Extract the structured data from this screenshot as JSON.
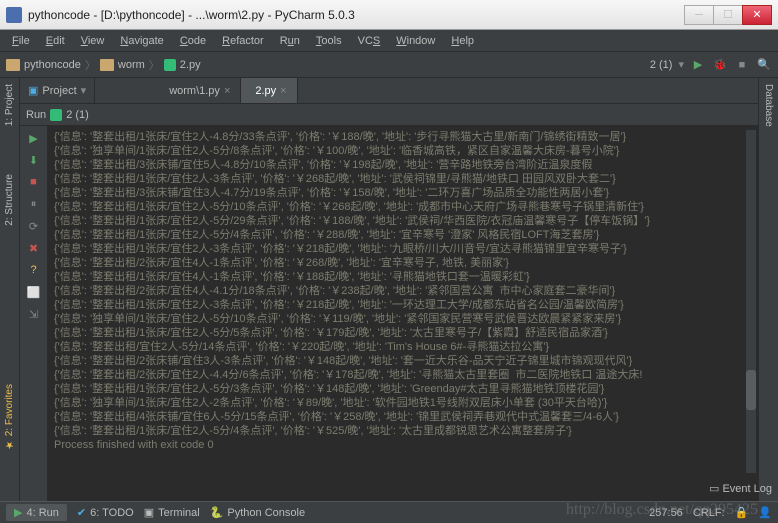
{
  "window": {
    "title": "pythoncode - [D:\\pythoncode] - ...\\worm\\2.py - PyCharm 5.0.3"
  },
  "menu": [
    "File",
    "Edit",
    "View",
    "Navigate",
    "Code",
    "Refactor",
    "Run",
    "Tools",
    "VCS",
    "Window",
    "Help"
  ],
  "breadcrumb": {
    "root": "pythoncode",
    "folder": "worm",
    "file": "2.py"
  },
  "runconfig": {
    "label": "2 (1)"
  },
  "project_btn": "Project",
  "tabs": [
    {
      "label": "worm\\1.py",
      "active": false
    },
    {
      "label": "2.py",
      "active": true
    }
  ],
  "run_header": {
    "label": "Run",
    "config": "2 (1)"
  },
  "side": {
    "project": "1: Project",
    "structure": "2: Structure",
    "favorites": "2: Favorites",
    "database": "Database"
  },
  "console_lines": [
    "{'信息': '整套出租/1张床/宜住2人-4.8分/33条点评', '价格': '￥188/晚', '地址': '步行寻熊猫大古里/新南门/锦绣街精致一居'}",
    "{'信息': '独享单间/1张床/宜住2人-5分/8条点评', '价格': '￥100/晚', '地址': '临香城高铁，紧区自家温馨大床房-暮号小院'}",
    "{'信息': '整套出租/3张床铺/宜住5人-4.8分/10条点评', '价格': '￥198起/晚', '地址': '营辛路地铁旁台湾阶近温泉度假",
    "{'信息': '整套出租/1张床/宜住2人-3条点评', '价格': '￥268起/晚', '地址': '武侯祠锦里/寻熊猫/地铁口 田园风双卧大套二'}",
    "{'信息': '整套出租/3张床铺/宜住3人-4.7分/19条点评', '价格': '￥158/晚', '地址': '二环万喜广场品质全功能性两居小套'}",
    "{'信息': '整套出租/1张床/宜住2人-5分/10条点评', '价格': '￥268起/晚', '地址': '成都市中心天府广场寻熊巷寒号子锅里清新住'}",
    "{'信息': '整套出租/1张床/宜住2人-5分/29条点评', '价格': '￥188/晚', '地址': '武侯祠/华西医院/衣冠庙温馨寒号子【停车饭锅】'}",
    "{'信息': '整套出租/1张床/宜住2人-5分/4条点评', '价格': '￥288/晚', '地址': '宜辛寒号 '澄家' 风格民宿LOFT海芝套房'}",
    "{'信息': '整套出租/1张床/宜住2人-3条点评', '价格': '￥218起/晚', '地址': '九眼桥/川大/川音号/宜达寻熊猫锦里宜辛寒号子'}",
    "{'信息': '整套出租/2张床/宜住4人-1条点评', '价格': '￥268/晚', '地址': '宜辛寒号子, 地铁, 美丽家'}",
    "{'信息': '整套出租/1张床/宜住4人-1条点评', '价格': '￥188起/晚', '地址': '寻熊猫地铁口套一温暖彩虹'}",
    "{'信息': '整套出租/2张床/宜住4人-4.1分/18条点评', '价格': '￥238起/晚', '地址': '紧邻国营公寓  市中心家庭套二豪华间'}",
    "{'信息': '整套出租/1张床/宜住2人-3条点评', '价格': '￥218起/晚', '地址': '一环达理工大学/成都东站省名公园/温馨欧简房'}",
    "{'信息': '独享单间/1张床/宜住2人-5分/10条点评', '价格': '￥119/晚', '地址': '紧邻国家民营寒号武侯晋达欧晨紧紧家来房'}",
    "{'信息': '整套出租/1张床/宜住2人-5分/5条点评', '价格': '￥179起/晚', '地址': '太古里寒号子/【紫霞】舒适民宿品家酒'}",
    "{'信息': '整套出租/宜住2人-5分/14条点评', '价格': '￥220起/晚', '地址': 'Tim's House 6#-寻熊猫达拉公寓'}",
    "{'信息': '整套出租/2张床铺/宜住3人-3条点评', '价格': '￥148起/晚', '地址': '套一近大乐谷-品天宁近子锦里城市锦观现代风'}",
    "{'信息': '整套出租/2张床/宜住2人-4.4分/6条点评', '价格': '￥178起/晚', '地址': '寻熊猫太古里套圈  市二医院地铁口 温途大床!",
    "{'信息': '整套出租/1张床/宜住2人-5分/3条点评', '价格': '￥148起/晚', '地址': 'Greenday#太古里寻熊猫地铁顶楼花园'}",
    "{'信息': '独享单间/1张床/宜住2人-2条点评', '价格': '￥89/晚', '地址': '软件园地铁1号线附双层床小单套 (30平天台哈)'}",
    "{'信息': '整套出租/4张床铺/宜住6人-5分/15条点评', '价格': '￥258/晚', '地址': '锦里武侯祠弄巷观代中式温馨套三/4-6人'}",
    "{'信息': '整套出租/1张床/宜住2人-5分/4条点评', '价格': '￥525/晚', '地址': '太古里成都锐思艺术公寓整套房子'}",
    "",
    "Process finished with exit code 0"
  ],
  "bottom": {
    "run": "4: Run",
    "todo": "6: TODO",
    "terminal": "Terminal",
    "pyconsole": "Python Console",
    "eventlog": "Event Log"
  },
  "status": {
    "pos": "257:56",
    "enc": "CRLF:",
    "extra": ""
  },
  "watermark": "http://blog.csdn.net/qq295425"
}
